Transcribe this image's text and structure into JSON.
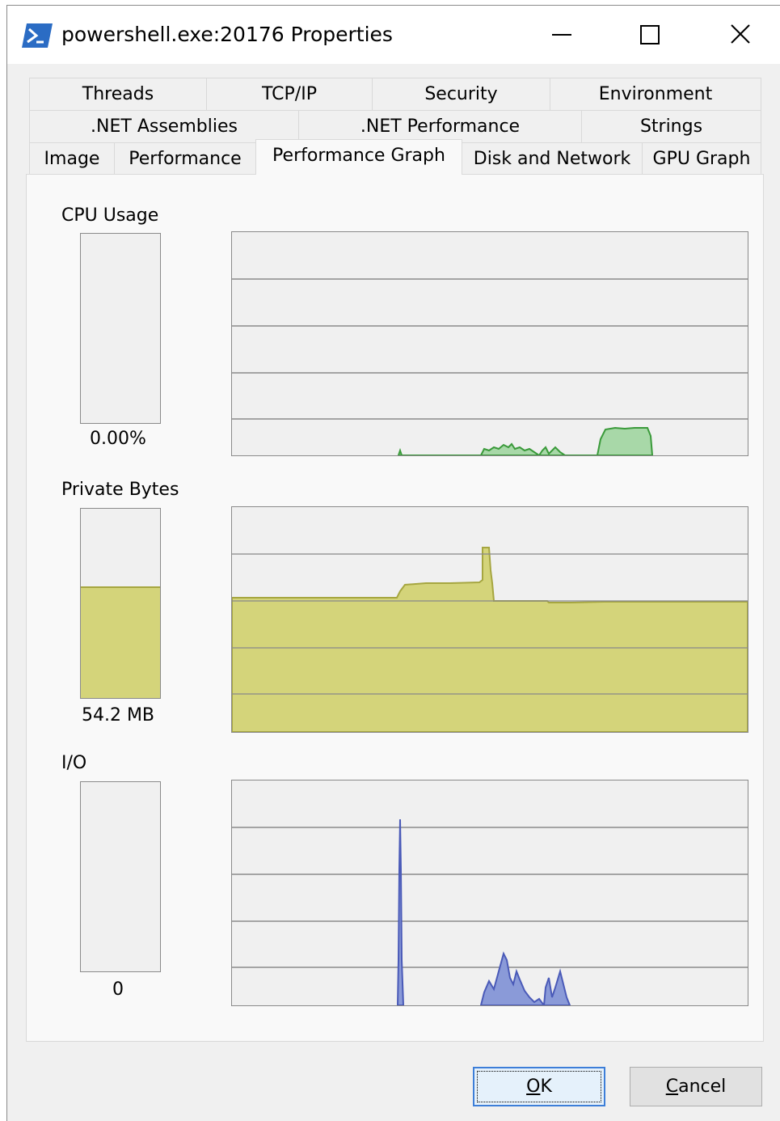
{
  "window": {
    "title": "powershell.exe:20176 Properties"
  },
  "tabs": {
    "row1": [
      "Threads",
      "TCP/IP",
      "Security",
      "Environment"
    ],
    "row2": [
      ".NET Assemblies",
      ".NET Performance",
      "Strings"
    ],
    "row3": [
      "Image",
      "Performance",
      "Performance Graph",
      "Disk and Network",
      "GPU Graph"
    ],
    "active": "Performance Graph"
  },
  "graphs": {
    "cpu": {
      "label": "CPU Usage",
      "value": "0.00%",
      "fill_fraction": 0.0,
      "color": "#5aaa5a"
    },
    "private_bytes": {
      "label": "Private Bytes",
      "value": "54.2 MB",
      "fill_fraction": 0.59,
      "color": "#d4d47a"
    },
    "io": {
      "label": "I/O",
      "value": "0",
      "fill_fraction": 0.0,
      "color": "#6a7fc8"
    }
  },
  "buttons": {
    "ok": {
      "mnemonic": "O",
      "rest": "K"
    },
    "cancel": {
      "mnemonic": "C",
      "rest": "ancel"
    }
  },
  "icons": [
    "powershell-icon",
    "minimize-icon",
    "maximize-icon",
    "close-icon"
  ],
  "colors": {
    "window_bg": "#f0f0f0",
    "panel_bg": "#f9f9f9",
    "accent": "#3d7ed8"
  }
}
